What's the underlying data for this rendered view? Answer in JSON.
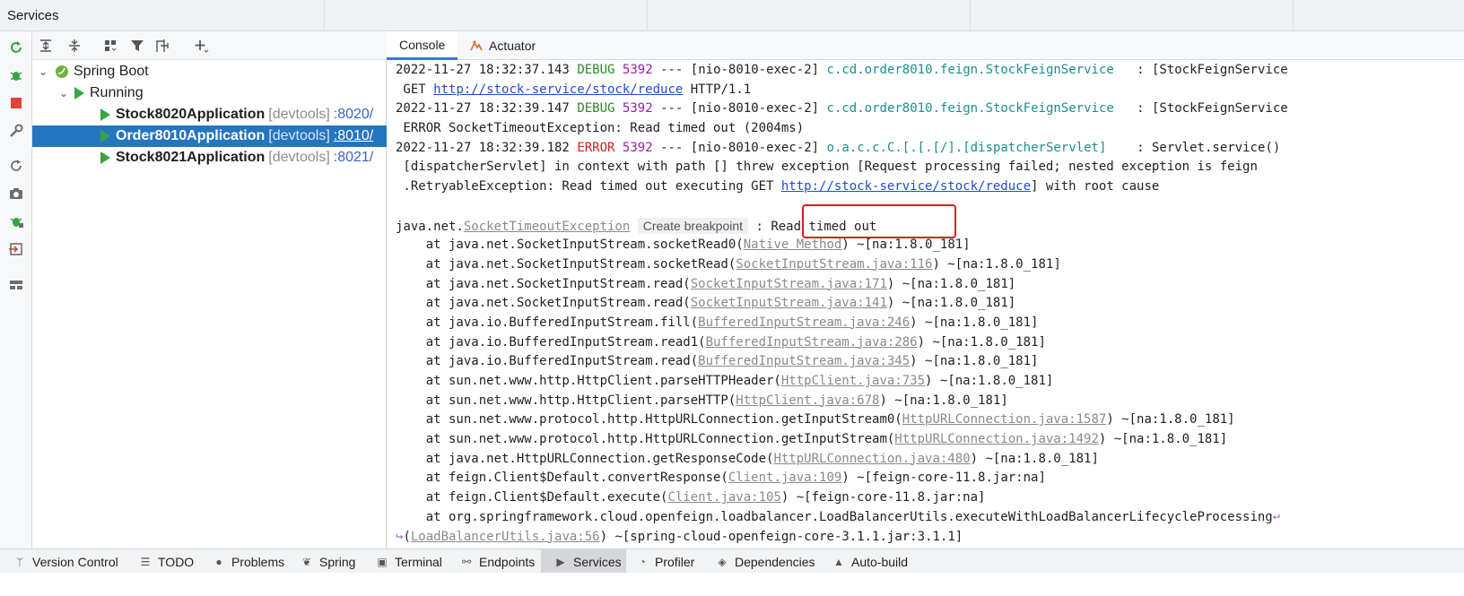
{
  "window": {
    "title": "Services"
  },
  "tree": {
    "root": {
      "label": "Spring Boot"
    },
    "group": {
      "label": "Running"
    },
    "apps": [
      {
        "name": "Stock8020Application",
        "tag": "[devtools]",
        "port": ":8020/"
      },
      {
        "name": "Order8010Application",
        "tag": "[devtools]",
        "port": ":8010/"
      },
      {
        "name": "Stock8021Application",
        "tag": "[devtools]",
        "port": ":8021/"
      }
    ]
  },
  "tabs": [
    {
      "label": "Console"
    },
    {
      "label": "Actuator"
    }
  ],
  "console": {
    "l1": {
      "ts": "2022-11-27 18:32:37.143",
      "level": "DEBUG",
      "pid": "5392",
      "sep": " --- ",
      "thread": "[nio-8010-exec-2]",
      "logger": "c.cd.order8010.feign.StockFeignService",
      "msg": "   : [StockFeignService"
    },
    "l2": {
      "pre": " GET ",
      "url": "http://stock-service/stock/reduce",
      "post": " HTTP/1.1"
    },
    "l3": {
      "ts": "2022-11-27 18:32:39.147",
      "level": "DEBUG",
      "pid": "5392",
      "sep": " --- ",
      "thread": "[nio-8010-exec-2]",
      "logger": "c.cd.order8010.feign.StockFeignService",
      "msg": "   : [StockFeignService"
    },
    "l4": {
      "text": " ERROR SocketTimeoutException: Read timed out (2004ms)"
    },
    "l5": {
      "ts": "2022-11-27 18:32:39.182",
      "level": "ERROR",
      "pid": "5392",
      "sep": " --- ",
      "thread": "[nio-8010-exec-2]",
      "logger": "o.a.c.c.C.[.[.[/].[dispatcherServlet]",
      "msg": "    : Servlet.service()"
    },
    "l6": {
      "text": " [dispatcherServlet] in context with path [] threw exception [Request processing failed; nested exception is feign"
    },
    "l7": {
      "pre": " .RetryableException: Read timed out executing GET ",
      "url": "http://stock-service/stock/reduce",
      "post": "] with root cause"
    },
    "l9": {
      "pre": "java.net.",
      "exc": "SocketTimeoutException",
      "bp": "Create breakpoint",
      "post": " : Read timed out"
    },
    "frames": [
      {
        "pre": "    at java.net.SocketInputStream.socketRead0(",
        "link": "Native Method",
        "post": ") ~[na:1.8.0_181]"
      },
      {
        "pre": "    at java.net.SocketInputStream.socketRead(",
        "link": "SocketInputStream.java:116",
        "post": ") ~[na:1.8.0_181]"
      },
      {
        "pre": "    at java.net.SocketInputStream.read(",
        "link": "SocketInputStream.java:171",
        "post": ") ~[na:1.8.0_181]"
      },
      {
        "pre": "    at java.net.SocketInputStream.read(",
        "link": "SocketInputStream.java:141",
        "post": ") ~[na:1.8.0_181]"
      },
      {
        "pre": "    at java.io.BufferedInputStream.fill(",
        "link": "BufferedInputStream.java:246",
        "post": ") ~[na:1.8.0_181]"
      },
      {
        "pre": "    at java.io.BufferedInputStream.read1(",
        "link": "BufferedInputStream.java:286",
        "post": ") ~[na:1.8.0_181]"
      },
      {
        "pre": "    at java.io.BufferedInputStream.read(",
        "link": "BufferedInputStream.java:345",
        "post": ") ~[na:1.8.0_181]"
      },
      {
        "pre": "    at sun.net.www.http.HttpClient.parseHTTPHeader(",
        "link": "HttpClient.java:735",
        "post": ") ~[na:1.8.0_181]"
      },
      {
        "pre": "    at sun.net.www.http.HttpClient.parseHTTP(",
        "link": "HttpClient.java:678",
        "post": ") ~[na:1.8.0_181]"
      },
      {
        "pre": "    at sun.net.www.protocol.http.HttpURLConnection.getInputStream0(",
        "link": "HttpURLConnection.java:1587",
        "post": ") ~[na:1.8.0_181]"
      },
      {
        "pre": "    at sun.net.www.protocol.http.HttpURLConnection.getInputStream(",
        "link": "HttpURLConnection.java:1492",
        "post": ") ~[na:1.8.0_181]"
      },
      {
        "pre": "    at java.net.HttpURLConnection.getResponseCode(",
        "link": "HttpURLConnection.java:480",
        "post": ") ~[na:1.8.0_181]"
      },
      {
        "pre": "    at feign.Client$Default.convertResponse(",
        "link": "Client.java:109",
        "post": ") ~[feign-core-11.8.jar:na]"
      },
      {
        "pre": "    at feign.Client$Default.execute(",
        "link": "Client.java:105",
        "post": ") ~[feign-core-11.8.jar:na]"
      }
    ],
    "last": {
      "text": "    at org.springframework.cloud.openfeign.loadbalancer.LoadBalancerUtils.executeWithLoadBalancerLifecycleProcessing"
    },
    "lastwrap": {
      "pre": "(",
      "link": "LoadBalancerUtils.java:56",
      "post": ") ~[spring-cloud-openfeign-core-3.1.1.jar:3.1.1]"
    }
  },
  "bottom": [
    {
      "label": "Version Control"
    },
    {
      "label": "TODO"
    },
    {
      "label": "Problems"
    },
    {
      "label": "Spring"
    },
    {
      "label": "Terminal"
    },
    {
      "label": "Endpoints"
    },
    {
      "label": "Services"
    },
    {
      "label": "Profiler"
    },
    {
      "label": "Dependencies"
    },
    {
      "label": "Auto-build"
    }
  ],
  "colors": {
    "accent": "#3574f0",
    "selection": "#2675bf",
    "highlight": "#e01a1a",
    "run": "#3aa345"
  }
}
